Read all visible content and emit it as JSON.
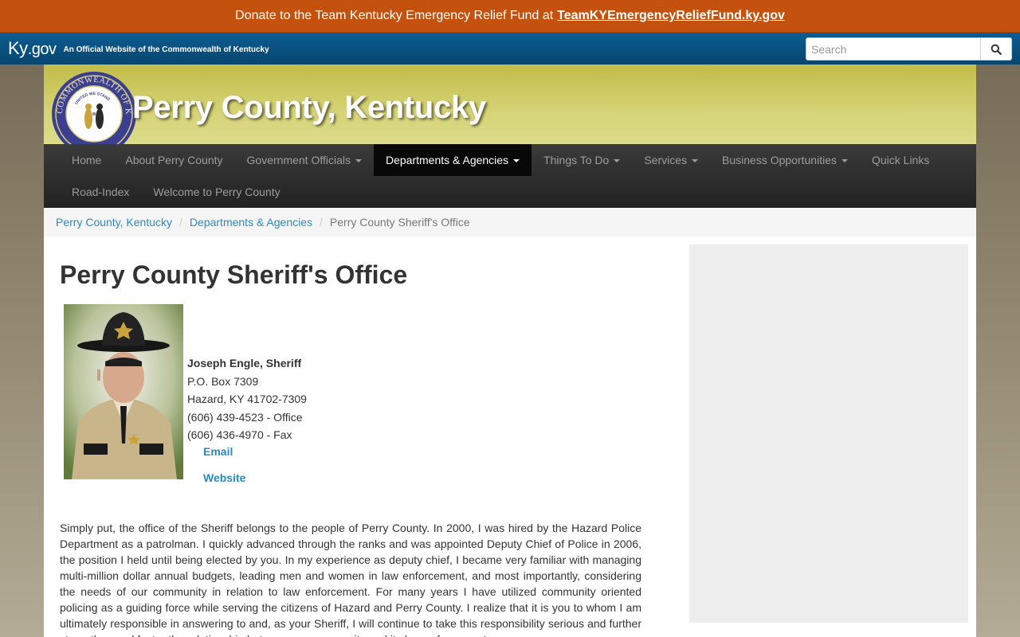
{
  "donate": {
    "text": "Donate to the Team Kentucky Emergency Relief Fund at",
    "link": "TeamKYEmergencyReliefFund.ky.gov"
  },
  "kygov": {
    "logo_main": "Ky",
    "logo_suffix": ".gov",
    "tagline": "An Official Website of the Commonwealth of Kentucky",
    "search_placeholder": "Search"
  },
  "header": {
    "title": "Perry County, Kentucky",
    "seal_text": "COMMONWEALTH OF KENTUCKY",
    "seal_motto": "UNITED WE STAND"
  },
  "nav": {
    "items": [
      {
        "label": "Home",
        "dropdown": false,
        "active": false
      },
      {
        "label": "About Perry County",
        "dropdown": false,
        "active": false
      },
      {
        "label": "Government Officials",
        "dropdown": true,
        "active": false
      },
      {
        "label": "Departments & Agencies",
        "dropdown": true,
        "active": true
      },
      {
        "label": "Things To Do",
        "dropdown": true,
        "active": false
      },
      {
        "label": "Services",
        "dropdown": true,
        "active": false
      },
      {
        "label": "Business Opportunities",
        "dropdown": true,
        "active": false
      },
      {
        "label": "Quick Links",
        "dropdown": false,
        "active": false
      },
      {
        "label": "Road-Index",
        "dropdown": false,
        "active": false
      },
      {
        "label": "Welcome to Perry County",
        "dropdown": false,
        "active": false
      }
    ]
  },
  "breadcrumb": {
    "home": "Perry County, Kentucky",
    "section": "Departments & Agencies",
    "current": "Perry County Sheriff's Office",
    "separator": "/"
  },
  "page": {
    "title": "Perry County Sheriff's Office",
    "contact": {
      "name": "Joseph Engle, Sheriff",
      "address1": "P.O. Box 7309",
      "address2": "Hazard, KY 41702-7309",
      "phone": "(606) 439-4523 - Office",
      "fax": "(606) 436-4970 - Fax",
      "email_label": "Email",
      "website_label": "Website"
    },
    "bio": "Simply put, the office of the Sheriff belongs to the people of Perry County. In 2000, I was hired by the Hazard Police Department as a patrolman. I quickly advanced through the ranks and was appointed Deputy Chief of Police in 2006, the position I held until being elected by you. In my experience as deputy chief, I became very familiar with managing multi-million dollar annual budgets, leading men and women in law enforcement, and most importantly, considering the needs of our community in relation to law enforcement. For many years I have utilized community oriented policing as a guiding force while serving the citizens of Hazard and Perry County. I realize that it is you to whom I am ultimately responsible in answering to and, as your Sheriff, I will continue to take this responsibility serious and further strengthen and foster the relationship between our community and its law enforcement."
  },
  "colors": {
    "donate_bg": "#c4510d",
    "kygov_bar": "#0c5d92",
    "header_olive": "#c2bc48",
    "nav_dark": "#222222",
    "link_blue": "#2a8ac2"
  }
}
